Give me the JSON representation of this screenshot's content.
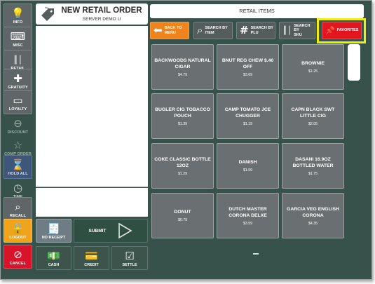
{
  "sidebar": {
    "items": [
      {
        "label": "INFO",
        "icon": "lightbulb-icon"
      },
      {
        "label": "MISC",
        "icon": "keyboard-icon"
      },
      {
        "label": "RETAIL",
        "icon": "barcode-icon"
      },
      {
        "label": "GRATUITY",
        "icon": "plus-icon"
      },
      {
        "label": "LOYALTY",
        "icon": "card-icon"
      },
      {
        "label": "DISCOUNT",
        "icon": "minus-circle-icon"
      },
      {
        "label": "COMP ORDER",
        "icon": "star-icon"
      },
      {
        "label": "HOLD ALL",
        "icon": "hourglass-icon"
      },
      {
        "label": "TIME",
        "icon": "clock-icon"
      },
      {
        "label": "RECALL",
        "icon": "search-icon"
      },
      {
        "label": "LOGOUT",
        "icon": "lock-icon"
      },
      {
        "label": "CANCEL",
        "icon": "cancel-icon"
      }
    ]
  },
  "order": {
    "title": "NEW RETAIL ORDER",
    "server": "SERVER DEMO U"
  },
  "bottom": {
    "no_receipt": "NO RECEIPT",
    "submit": "SUBMIT",
    "cash": "CASH",
    "credit": "CREDIT",
    "settle": "SETTLE"
  },
  "items_header": "RETAIL ITEMS",
  "toolbar": {
    "back": [
      "BACK TO",
      "MENU"
    ],
    "search_item": [
      "SEARCH BY",
      "ITEM"
    ],
    "search_plu": [
      "SEARCH BY",
      "PLU"
    ],
    "search_sku": [
      "SEARCH BY",
      "SKU"
    ],
    "favorites": "FAVORITES"
  },
  "items": [
    {
      "name": "BACKWOODS NATURAL CIGAR",
      "price": "$4.79"
    },
    {
      "name": "BNUT REG CHEW $.40 OFF",
      "price": "$3.69"
    },
    {
      "name": "BROWNIE",
      "price": "$1.25"
    },
    {
      "name": "BUGLER CIG TOBACCO POUCH",
      "price": "$1.39"
    },
    {
      "name": "CAMP TOMATO JCE CHUGGER",
      "price": "$1.19"
    },
    {
      "name": "CAPN BLACK SWT LITTLE CIG",
      "price": "$2.05"
    },
    {
      "name": "COKE CLASSIC BOTTLE 12OZ",
      "price": "$1.29"
    },
    {
      "name": "DANISH",
      "price": "$1.59"
    },
    {
      "name": "DASANI 16.9OZ BOTTLED WATER",
      "price": "$1.75"
    },
    {
      "name": "DONUT",
      "price": "$0.79"
    },
    {
      "name": "DUTCH MASTER CORONA DELXE",
      "price": "$3.59"
    },
    {
      "name": "GARCIA VEG ENGLISH CORONA",
      "price": "$4.35"
    }
  ],
  "colors": {
    "background": "#37524a",
    "tile": "#6a7071",
    "orange": "#f0841c",
    "red": "#e3151e",
    "highlight": "#f2ee0c"
  }
}
